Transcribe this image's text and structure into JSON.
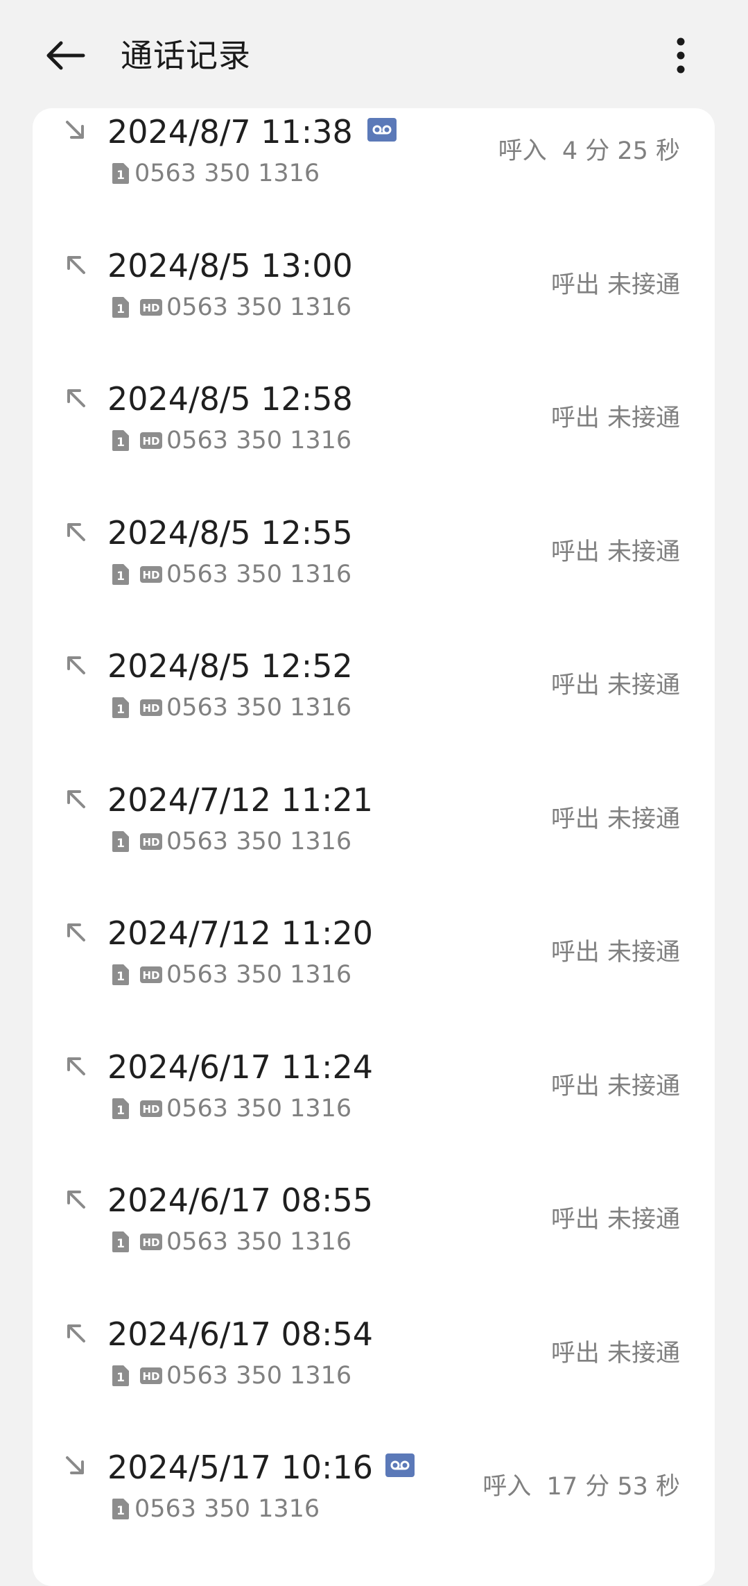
{
  "header": {
    "title": "通话记录",
    "back_icon": "arrow-left-icon",
    "more_icon": "more-vertical-icon"
  },
  "colors": {
    "background": "#f2f2f2",
    "card": "#ffffff",
    "primary_text": "#1f1f1f",
    "secondary_text": "#808080",
    "voicemail_badge": "#5b79b8"
  },
  "calls": [
    {
      "direction": "incoming",
      "date": "2024/8/7 11:38",
      "recorded": true,
      "sim": "1",
      "hd": false,
      "number": "0563 350 1316",
      "status": "呼入  4 分 25 秒"
    },
    {
      "direction": "outgoing",
      "date": "2024/8/5 13:00",
      "recorded": false,
      "sim": "1",
      "hd": true,
      "number": "0563 350 1316",
      "status": "呼出 未接通"
    },
    {
      "direction": "outgoing",
      "date": "2024/8/5 12:58",
      "recorded": false,
      "sim": "1",
      "hd": true,
      "number": "0563 350 1316",
      "status": "呼出 未接通"
    },
    {
      "direction": "outgoing",
      "date": "2024/8/5 12:55",
      "recorded": false,
      "sim": "1",
      "hd": true,
      "number": "0563 350 1316",
      "status": "呼出 未接通"
    },
    {
      "direction": "outgoing",
      "date": "2024/8/5 12:52",
      "recorded": false,
      "sim": "1",
      "hd": true,
      "number": "0563 350 1316",
      "status": "呼出 未接通"
    },
    {
      "direction": "outgoing",
      "date": "2024/7/12 11:21",
      "recorded": false,
      "sim": "1",
      "hd": true,
      "number": "0563 350 1316",
      "status": "呼出 未接通"
    },
    {
      "direction": "outgoing",
      "date": "2024/7/12 11:20",
      "recorded": false,
      "sim": "1",
      "hd": true,
      "number": "0563 350 1316",
      "status": "呼出 未接通"
    },
    {
      "direction": "outgoing",
      "date": "2024/6/17 11:24",
      "recorded": false,
      "sim": "1",
      "hd": true,
      "number": "0563 350 1316",
      "status": "呼出 未接通"
    },
    {
      "direction": "outgoing",
      "date": "2024/6/17 08:55",
      "recorded": false,
      "sim": "1",
      "hd": true,
      "number": "0563 350 1316",
      "status": "呼出 未接通"
    },
    {
      "direction": "outgoing",
      "date": "2024/6/17 08:54",
      "recorded": false,
      "sim": "1",
      "hd": true,
      "number": "0563 350 1316",
      "status": "呼出 未接通"
    },
    {
      "direction": "incoming",
      "date": "2024/5/17 10:16",
      "recorded": true,
      "sim": "1",
      "hd": false,
      "number": "0563 350 1316",
      "status": "呼入  17 分 53 秒"
    }
  ]
}
